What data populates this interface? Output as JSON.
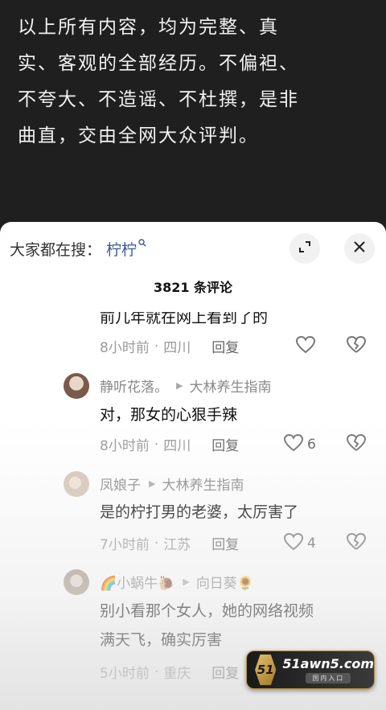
{
  "video": {
    "text": "以上所有内容，均为完整、真实、客观的全部经历。不偏袒、不夸大、不造谣、不杜撰，是非曲直，交由全网大众评判。"
  },
  "sheet": {
    "search_prefix": "大家都在搜：",
    "search_keyword": "柠柠",
    "comment_count_title": "3821 条评论"
  },
  "comments": [
    {
      "text": "前几年就在网上看到了的",
      "time": "8小时前",
      "location": "四川",
      "reply_label": "回复",
      "likes": ""
    },
    {
      "author": "静听花落。",
      "reply_to": "大林养生指南",
      "text": "对，那女的心狠手辣",
      "time": "8小时前",
      "location": "四川",
      "reply_label": "回复",
      "likes": "6"
    },
    {
      "author": "凤娘子",
      "reply_to": "大林养生指南",
      "text": "是的柠打男的老婆，太厉害了",
      "time": "7小时前",
      "location": "江苏",
      "reply_label": "回复",
      "likes": "4"
    },
    {
      "author": "🌈小蜗牛🐌",
      "reply_to": "向日葵🌻",
      "text_line1": "别小看那个女人，她的网络视频",
      "text_line2": "满天飞，确实厉害",
      "time": "5小时前",
      "location": "重庆",
      "reply_label": "回复"
    }
  ],
  "meta_separator": "·",
  "watermark": {
    "logo": "51",
    "domain": "51awn5.com",
    "sub": "国内入口"
  },
  "colors": {
    "keyword": "#3d5a99",
    "sheet_bg": "#ffffff",
    "video_bg": "#1f1f1f"
  }
}
